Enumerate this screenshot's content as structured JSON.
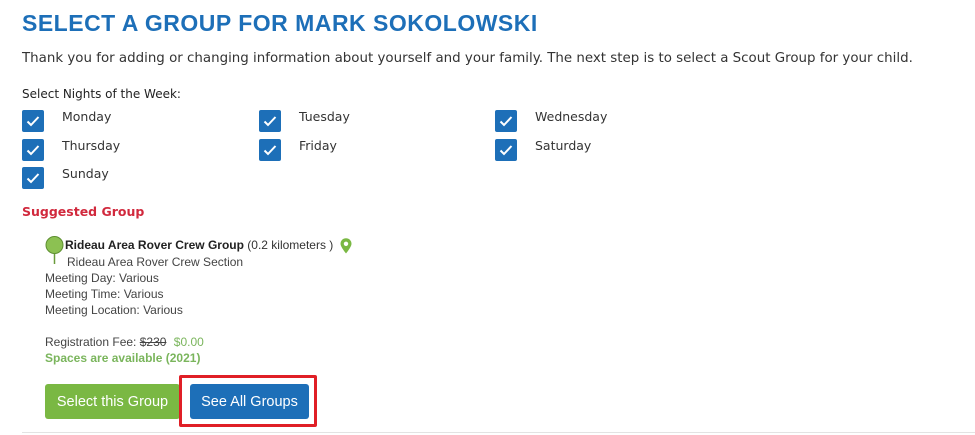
{
  "page": {
    "title": "SELECT A GROUP FOR MARK SOKOLOWSKI",
    "intro": "Thank you for adding or changing information about yourself and your family. The next step is to select a Scout Group for your child."
  },
  "nights": {
    "label": "Select Nights of the Week",
    "label_suffix": ":",
    "days": [
      {
        "label": "Monday",
        "checked": true
      },
      {
        "label": "Tuesday",
        "checked": true
      },
      {
        "label": "Wednesday",
        "checked": true
      },
      {
        "label": "Thursday",
        "checked": true
      },
      {
        "label": "Friday",
        "checked": true
      },
      {
        "label": "Saturday",
        "checked": true
      },
      {
        "label": "Sunday",
        "checked": true
      }
    ]
  },
  "suggested": {
    "heading": "Suggested Group",
    "group_name": "Rideau Area Rover Crew Group",
    "distance": "(0.2 kilometers )",
    "section": "Rideau Area Rover Crew Section",
    "meeting_day": "Meeting Day: Various",
    "meeting_time": "Meeting Time: Various",
    "meeting_location": "Meeting Location: Various",
    "fee_label": "Registration Fee:",
    "fee_original": "$230",
    "fee_current": "$0.00",
    "spaces": "Spaces are available (2021)"
  },
  "buttons": {
    "select_label": "Select this Group",
    "see_all_label": "See All Groups"
  },
  "colors": {
    "brand_blue": "#1d6fb8",
    "accent_green": "#7ab843",
    "alert_red": "#d1293d",
    "highlight_red": "#e01f26"
  },
  "icons": {
    "checkbox": "checkmark-icon",
    "pin": "map-pin-icon"
  }
}
